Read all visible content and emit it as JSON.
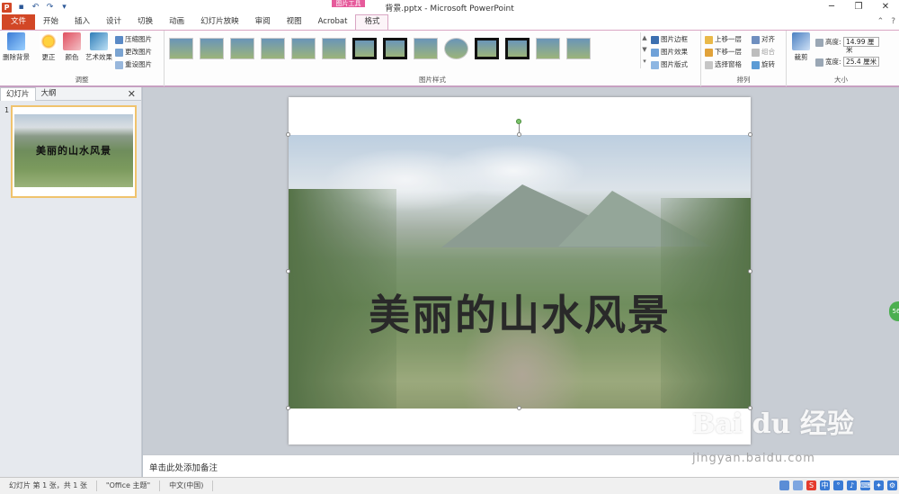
{
  "window": {
    "title": "背景.pptx - Microsoft PowerPoint",
    "context_tab_group": "图片工具",
    "controls": [
      "─",
      "❐",
      "✕"
    ]
  },
  "tabs": [
    "文件",
    "开始",
    "插入",
    "设计",
    "切换",
    "动画",
    "幻灯片放映",
    "审阅",
    "视图",
    "Acrobat",
    "格式"
  ],
  "active_tab": "格式",
  "ribbon": {
    "adjust": {
      "remove_bg": "删除背景",
      "correct": "更正",
      "color": "颜色",
      "artistic": "艺术效果",
      "compress": "压缩图片",
      "change": "更改图片",
      "reset": "重设图片",
      "label": "调整"
    },
    "styles": {
      "label": "图片样式",
      "border": "图片边框",
      "effects": "图片效果",
      "layout": "图片版式"
    },
    "arrange": {
      "label": "排列",
      "bring_forward": "上移一层",
      "send_backward": "下移一层",
      "selection_pane": "选择窗格",
      "align": "对齐",
      "group": "组合",
      "rotate": "旋转"
    },
    "size": {
      "label": "大小",
      "crop": "裁剪",
      "height_label": "高度:",
      "height_value": "14.99 厘米",
      "width_label": "宽度:",
      "width_value": "25.4 厘米"
    }
  },
  "left_panel": {
    "tabs": [
      "幻灯片",
      "大纲"
    ],
    "slide_number": "1",
    "thumb_title": "美丽的山水风景"
  },
  "slide": {
    "title": "美丽的山水风景"
  },
  "notes_placeholder": "单击此处添加备注",
  "status": {
    "slide_info": "幻灯片 第 1 张，共 1 张",
    "theme": "\"Office 主题\"",
    "language": "中文(中国)"
  },
  "watermark": {
    "main": "Bai du 经验",
    "sub": "jingyan.baidu.com"
  },
  "colors": {
    "file_tab": "#d24726",
    "context_pink": "#e65a9b",
    "selection_thumb": "#f0c36d"
  }
}
